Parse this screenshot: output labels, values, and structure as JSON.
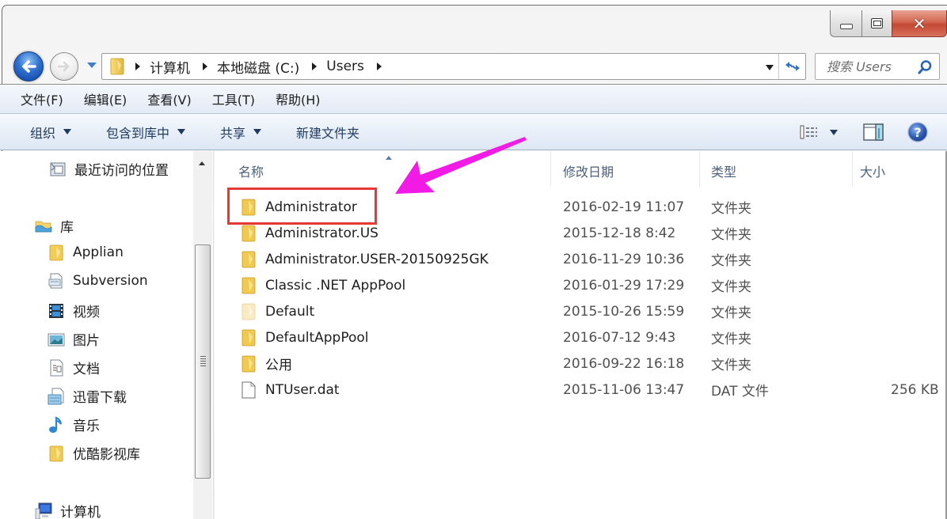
{
  "window": {
    "caption_buttons": [
      "minimize",
      "maximize",
      "close"
    ]
  },
  "address": {
    "breadcrumbs": [
      "计算机",
      "本地磁盘 (C:)",
      "Users"
    ],
    "search_placeholder": "搜索 Users"
  },
  "menubar": {
    "items": [
      "文件(F)",
      "编辑(E)",
      "查看(V)",
      "工具(T)",
      "帮助(H)"
    ]
  },
  "commandbar": {
    "buttons": [
      {
        "label": "组织",
        "has_dropdown": true
      },
      {
        "label": "包含到库中",
        "has_dropdown": true
      },
      {
        "label": "共享",
        "has_dropdown": true
      },
      {
        "label": "新建文件夹",
        "has_dropdown": false
      }
    ]
  },
  "navpane": {
    "recent": "最近访问的位置",
    "libraries": "库",
    "library_items": [
      {
        "label": "Applian",
        "icon": "folder-icon"
      },
      {
        "label": "Subversion",
        "icon": "library-doc-icon"
      },
      {
        "label": "视频",
        "icon": "video-icon"
      },
      {
        "label": "图片",
        "icon": "picture-icon"
      },
      {
        "label": "文档",
        "icon": "document-icon"
      },
      {
        "label": "迅雷下载",
        "icon": "download-icon"
      },
      {
        "label": "音乐",
        "icon": "music-icon"
      },
      {
        "label": "优酷影视库",
        "icon": "folder-icon"
      }
    ],
    "computer": "计算机"
  },
  "filelist": {
    "columns": [
      "名称",
      "修改日期",
      "类型",
      "大小"
    ],
    "rows": [
      {
        "name": "Administrator",
        "date": "2016-02-19 11:07",
        "type": "文件夹",
        "size": "",
        "icon": "folder-icon",
        "highlighted": true
      },
      {
        "name": "Administrator.US",
        "date": "2015-12-18 8:42",
        "type": "文件夹",
        "size": "",
        "icon": "folder-icon"
      },
      {
        "name": "Administrator.USER-20150925GK",
        "date": "2016-11-29 10:36",
        "type": "文件夹",
        "size": "",
        "icon": "folder-icon"
      },
      {
        "name": "Classic .NET AppPool",
        "date": "2016-01-29 17:29",
        "type": "文件夹",
        "size": "",
        "icon": "folder-icon"
      },
      {
        "name": "Default",
        "date": "2015-10-26 15:59",
        "type": "文件夹",
        "size": "",
        "icon": "folder-hidden-icon"
      },
      {
        "name": "DefaultAppPool",
        "date": "2016-07-12 9:43",
        "type": "文件夹",
        "size": "",
        "icon": "folder-icon"
      },
      {
        "name": "公用",
        "date": "2016-09-22 16:18",
        "type": "文件夹",
        "size": "",
        "icon": "folder-icon"
      },
      {
        "name": "NTUser.dat",
        "date": "2015-11-06 13:47",
        "type": "DAT 文件",
        "size": "256 KB",
        "icon": "file-icon"
      }
    ]
  },
  "annotation": {
    "highlight_color": "#e53935",
    "arrow_color": "#f21be6"
  }
}
